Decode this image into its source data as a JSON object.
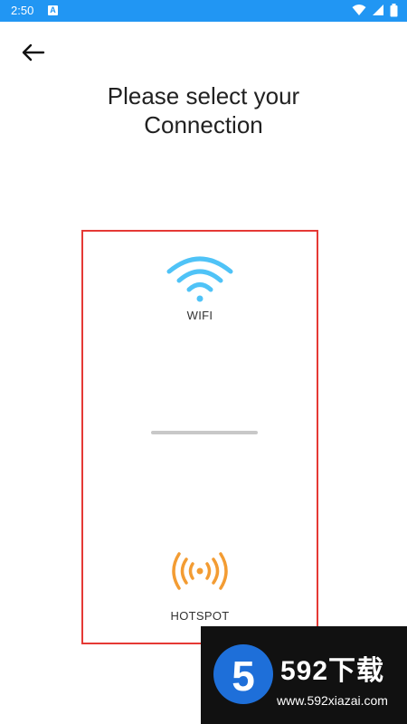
{
  "status_bar": {
    "time": "2:50",
    "notification_letter": "A",
    "icons": [
      "wifi-icon",
      "signal-icon",
      "battery-icon"
    ],
    "color": "#2196f3"
  },
  "header": {
    "back_icon": "arrow-left-icon",
    "title_line1": "Please select your",
    "title_line2": "Connection"
  },
  "options": {
    "wifi": {
      "label": "WIFI",
      "icon": "wifi-icon",
      "color": "#4fc3f7"
    },
    "hotspot": {
      "label": "HOTSPOT",
      "icon": "hotspot-icon",
      "color": "#f39c33"
    }
  },
  "card": {
    "border_color": "#e53935"
  },
  "watermark": {
    "logo_digit": "5",
    "brand": "592下载",
    "url": "www.592xiazai.com"
  }
}
